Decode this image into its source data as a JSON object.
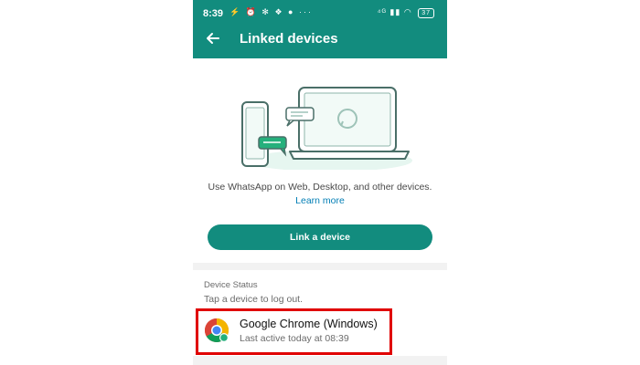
{
  "statusbar": {
    "time": "8:39",
    "left_icons": "⚡ ⏰ ✻ ❖ ● ···",
    "right_icons": "⁴ᴳ ▮▮ ◠",
    "battery": "37"
  },
  "appbar": {
    "title": "Linked devices"
  },
  "main": {
    "description": "Use WhatsApp on Web, Desktop, and other devices.",
    "learn_more": "Learn more",
    "link_button": "Link a device"
  },
  "device_status": {
    "title": "Device Status",
    "hint": "Tap a device to log out.",
    "devices": [
      {
        "name": "Google Chrome (Windows)",
        "status": "Last active today at 08:39",
        "icon": "chrome-icon"
      }
    ]
  },
  "colors": {
    "primary": "#128c7e",
    "link": "#027eb5",
    "highlight": "#e00000"
  }
}
